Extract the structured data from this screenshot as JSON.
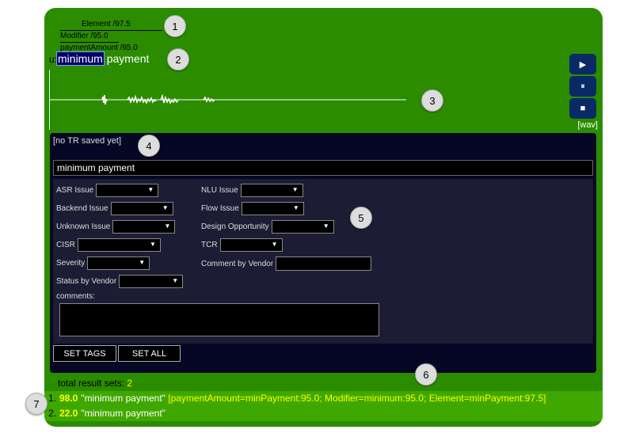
{
  "tree": {
    "element": "Element /97.5",
    "modifier": "Modifier /95.0",
    "payment_amount": "paymentAmount /95.0"
  },
  "utterance": {
    "prefix": "u:",
    "highlighted": "minimum",
    "rest": "payment"
  },
  "controls": {
    "wav_link": "[wav]"
  },
  "transcription": {
    "status": "[no TR saved yet]",
    "value": "minimum payment"
  },
  "form": {
    "asr_issue": "ASR Issue",
    "nlu_issue": "NLU Issue",
    "backend_issue": "Backend Issue",
    "flow_issue": "Flow Issue",
    "unknown_issue": "Unknown Issue",
    "design_opportunity": "Design Opportunity",
    "cisr": "CISR",
    "tcr": "TCR",
    "severity": "Severity",
    "comment_by_vendor": "Comment by Vendor",
    "status_by_vendor": "Status by Vendor",
    "comments": "comments:"
  },
  "buttons": {
    "set_tags": "SET TAGS",
    "set_all": "SET ALL"
  },
  "results": {
    "total_label": "total result sets:",
    "total": "2",
    "items": [
      {
        "num": "1.",
        "score": "98.0",
        "text": "\"minimum payment\"",
        "tags": "[paymentAmount=minPayment:95.0; Modifier=minimum:95.0; Element=minPayment:97.5]"
      },
      {
        "num": "2.",
        "score": "22.0",
        "text": "\"minimum payment\"",
        "tags": ""
      }
    ]
  },
  "badges": [
    "1",
    "2",
    "3",
    "4",
    "5",
    "6",
    "7"
  ],
  "colors": {
    "panel": "#2b8c00",
    "dark": "#060625",
    "score": "#ffff00"
  }
}
